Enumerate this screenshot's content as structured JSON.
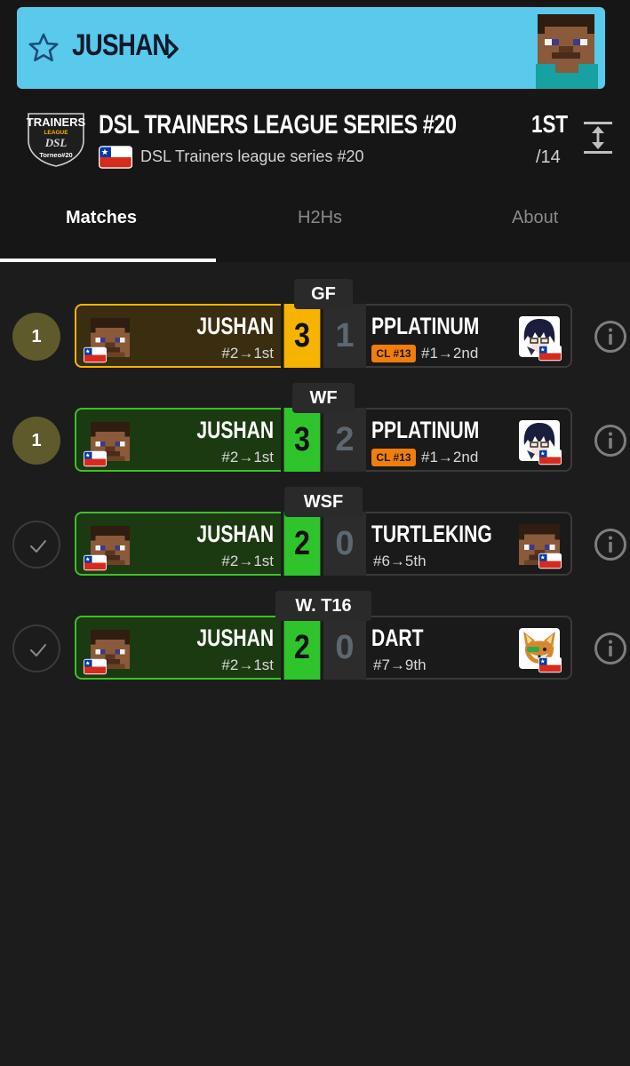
{
  "player": {
    "name": "JUSHAN"
  },
  "tournament": {
    "title": "DSL TRAINERS LEAGUE SERIES #20",
    "subtitle": "DSL Trainers league series #20",
    "placement": "1ST",
    "total": "/14",
    "logo": {
      "line1": "TRAINERS",
      "line2": "LEAGUE",
      "line3": "DSL",
      "line4": "Torneo#20"
    }
  },
  "tabs": [
    {
      "label": "Matches",
      "active": true
    },
    {
      "label": "H2Hs",
      "active": false
    },
    {
      "label": "About",
      "active": false
    }
  ],
  "matches": [
    {
      "round": "GF",
      "status_type": "number",
      "status": "1",
      "p1_name": "JUSHAN",
      "p1_seed": "#2→1st",
      "p1_score": "3",
      "opp_name": "PPLATINUM",
      "opp_seed": "#1→2nd",
      "opp_score": "1",
      "opp_badge": "CL #13",
      "opp_icon": "anime-avatar-icon",
      "style": "gold"
    },
    {
      "round": "WF",
      "status_type": "number",
      "status": "1",
      "p1_name": "JUSHAN",
      "p1_seed": "#2→1st",
      "p1_score": "3",
      "opp_name": "PPLATINUM",
      "opp_seed": "#1→2nd",
      "opp_score": "2",
      "opp_badge": "CL #13",
      "opp_icon": "anime-avatar-icon",
      "style": "green"
    },
    {
      "round": "WSF",
      "status_type": "check",
      "status": "",
      "p1_name": "JUSHAN",
      "p1_seed": "#2→1st",
      "p1_score": "2",
      "opp_name": "TURTLEKING",
      "opp_seed": "#6→5th",
      "opp_score": "0",
      "opp_badge": "",
      "opp_icon": "steve-avatar-icon",
      "style": "green"
    },
    {
      "round": "W. T16",
      "status_type": "check",
      "status": "",
      "p1_name": "JUSHAN",
      "p1_seed": "#2→1st",
      "p1_score": "2",
      "opp_name": "DART",
      "opp_seed": "#7→9th",
      "opp_score": "0",
      "opp_badge": "",
      "opp_icon": "fox-avatar-icon",
      "style": "green"
    }
  ],
  "colors": {
    "banner": "#59c9ec",
    "gold": "#f6b300",
    "green": "#2fc42b",
    "badge": "#f07d0c",
    "background": "#1c1c1c"
  }
}
